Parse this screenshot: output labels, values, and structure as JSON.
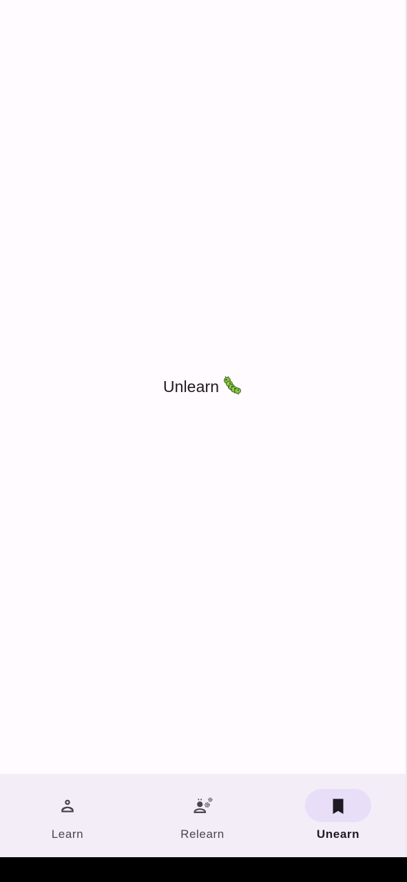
{
  "main": {
    "text": "Unlearn",
    "emoji_icon": "caterpillar-icon"
  },
  "nav": {
    "items": [
      {
        "label": "Learn",
        "icon": "person-outline-icon",
        "active": false
      },
      {
        "label": "Relearn",
        "icon": "person-gears-icon",
        "active": false
      },
      {
        "label": "Unearn",
        "icon": "bookmark-icon",
        "active": true
      }
    ]
  },
  "colors": {
    "background": "#fffbfe",
    "nav_background": "#f3edf7",
    "active_indicator": "#e8def8",
    "text_primary": "#1d1b20",
    "text_secondary": "#49454f"
  }
}
